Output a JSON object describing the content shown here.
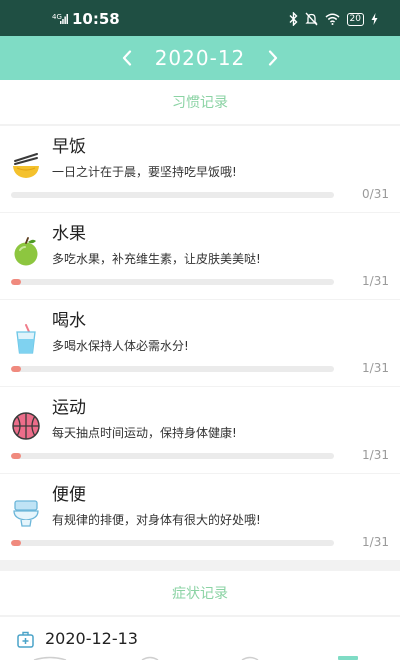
{
  "status_bar": {
    "time": "10:58",
    "network": "4G",
    "battery": "20"
  },
  "header": {
    "month": "2020-12",
    "prev_icon": "chevron-left-icon",
    "next_icon": "chevron-right-icon"
  },
  "habits_section": {
    "title": "习惯记录",
    "items": [
      {
        "name": "早饭",
        "desc": "一日之计在于晨，要坚持吃早饭哦!",
        "count": "0/31",
        "progress": 0,
        "icon": "noodle-bowl-icon"
      },
      {
        "name": "水果",
        "desc": "多吃水果，补充维生素，让皮肤美美哒!",
        "count": "1/31",
        "progress": 0.0323,
        "icon": "apple-icon"
      },
      {
        "name": "喝水",
        "desc": "多喝水保持人体必需水分!",
        "count": "1/31",
        "progress": 0.0323,
        "icon": "water-glass-icon"
      },
      {
        "name": "运动",
        "desc": "每天抽点时间运动，保持身体健康!",
        "count": "1/31",
        "progress": 0.0323,
        "icon": "basketball-icon"
      },
      {
        "name": "便便",
        "desc": "有规律的排便，对身体有很大的好处哦!",
        "count": "1/31",
        "progress": 0.0323,
        "icon": "toilet-icon"
      }
    ]
  },
  "symptoms_section": {
    "title": "症状记录",
    "date": "2020-12-13",
    "date_icon": "medical-kit-icon"
  },
  "colors": {
    "status_bar": "#1f4f43",
    "header": "#7fdcc5",
    "section_title": "#8bd3a4",
    "progress_fill": "#f08a7e",
    "progress_track": "#ebebeb"
  }
}
